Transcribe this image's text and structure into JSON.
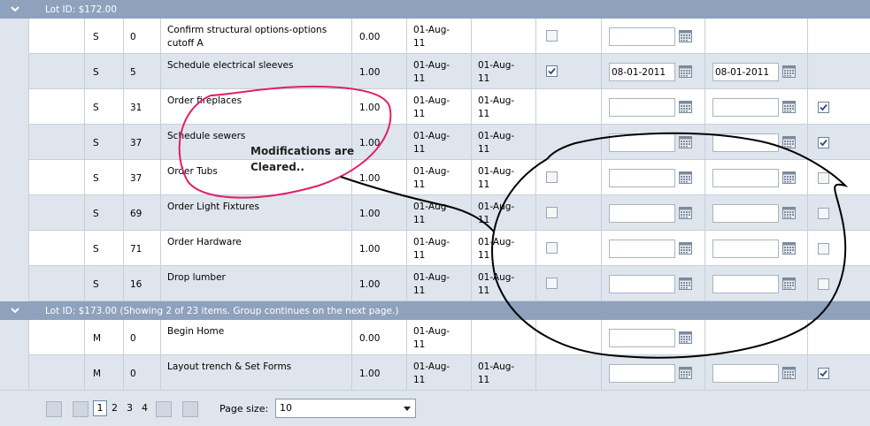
{
  "colors": {
    "header_bg": "#8ea1bd",
    "row_alt": "#dfe5ed",
    "annotation_pink": "#e0206a",
    "annotation_black": "#000000"
  },
  "groups": [
    {
      "label": "Lot ID: $172.00"
    },
    {
      "label": "Lot ID: $173.00 (Showing 2 of 23 items. Group continues on the next page.)"
    }
  ],
  "rows": [
    {
      "type": "S",
      "num": "0",
      "desc": "Confirm structural options-options cutoff A",
      "qty": "0.00",
      "date1": "01-Aug-11",
      "date2": "",
      "check1": "off",
      "in1": "",
      "in2": null,
      "check2": null
    },
    {
      "type": "S",
      "num": "5",
      "desc": "Schedule electrical sleeves",
      "qty": "1.00",
      "date1": "01-Aug-11",
      "date2": "01-Aug-11",
      "check1": "on",
      "in1": "08-01-2011",
      "in2": "08-01-2011",
      "check2": null
    },
    {
      "type": "S",
      "num": "31",
      "desc": "Order fireplaces",
      "qty": "1.00",
      "date1": "01-Aug-11",
      "date2": "01-Aug-11",
      "check1": null,
      "in1": "",
      "in2": "",
      "check2": "on"
    },
    {
      "type": "S",
      "num": "37",
      "desc": "Schedule sewers",
      "qty": "1.00",
      "date1": "01-Aug-11",
      "date2": "01-Aug-11",
      "check1": null,
      "in1": "",
      "in2": "",
      "check2": "on"
    },
    {
      "type": "S",
      "num": "37",
      "desc": "Order Tubs",
      "qty": "1.00",
      "date1": "01-Aug-11",
      "date2": "01-Aug-11",
      "check1": "off",
      "in1": "",
      "in2": "",
      "check2": "off"
    },
    {
      "type": "S",
      "num": "69",
      "desc": "Order Light Fixtures",
      "qty": "1.00",
      "date1": "01-Aug-11",
      "date2": "01-Aug-11",
      "check1": "off",
      "in1": "",
      "in2": "",
      "check2": "off"
    },
    {
      "type": "S",
      "num": "71",
      "desc": "Order Hardware",
      "qty": "1.00",
      "date1": "01-Aug-11",
      "date2": "01-Aug-11",
      "check1": "off",
      "in1": "",
      "in2": "",
      "check2": "off"
    },
    {
      "type": "S",
      "num": "16",
      "desc": "Drop lumber",
      "qty": "1.00",
      "date1": "01-Aug-11",
      "date2": "01-Aug-11",
      "check1": "off",
      "in1": "",
      "in2": "",
      "check2": "off"
    },
    {
      "type": "M",
      "num": "0",
      "desc": "Begin Home",
      "qty": "0.00",
      "date1": "01-Aug-11",
      "date2": "",
      "check1": null,
      "in1": "",
      "in2": null,
      "check2": null
    },
    {
      "type": "M",
      "num": "0",
      "desc": "Layout trench & Set Forms",
      "qty": "1.00",
      "date1": "01-Aug-11",
      "date2": "01-Aug-11",
      "check1": null,
      "in1": "",
      "in2": "",
      "check2": "on"
    }
  ],
  "pager": {
    "pages": [
      "1",
      "2",
      "3",
      "4"
    ],
    "current": "1",
    "page_size_label": "Page size:",
    "page_size_value": "10"
  },
  "annotation": {
    "text": "Modifications are Cleared.."
  }
}
